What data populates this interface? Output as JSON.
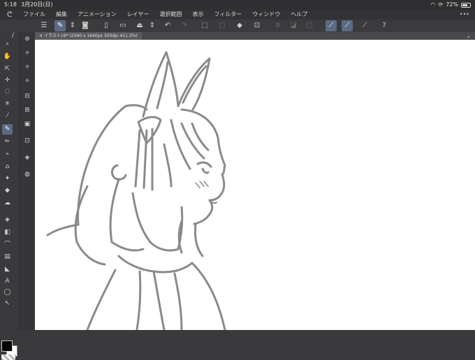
{
  "status": {
    "time": "5:18",
    "date": "3月20日(日)",
    "battery": "72%",
    "battery_level": 0.72
  },
  "menu": {
    "items": [
      "ファイル",
      "編集",
      "アニメーション",
      "レイヤー",
      "選択範囲",
      "表示",
      "フィルター",
      "ウィンドウ",
      "ヘルプ"
    ]
  },
  "tab": {
    "title": "イラスト19* (2360 x 1640px 300dpi 411.3%)"
  },
  "colors": {
    "accent": "#5b6b86",
    "chrome": "#3a3a3c",
    "stroke": "#8a8a8a"
  }
}
